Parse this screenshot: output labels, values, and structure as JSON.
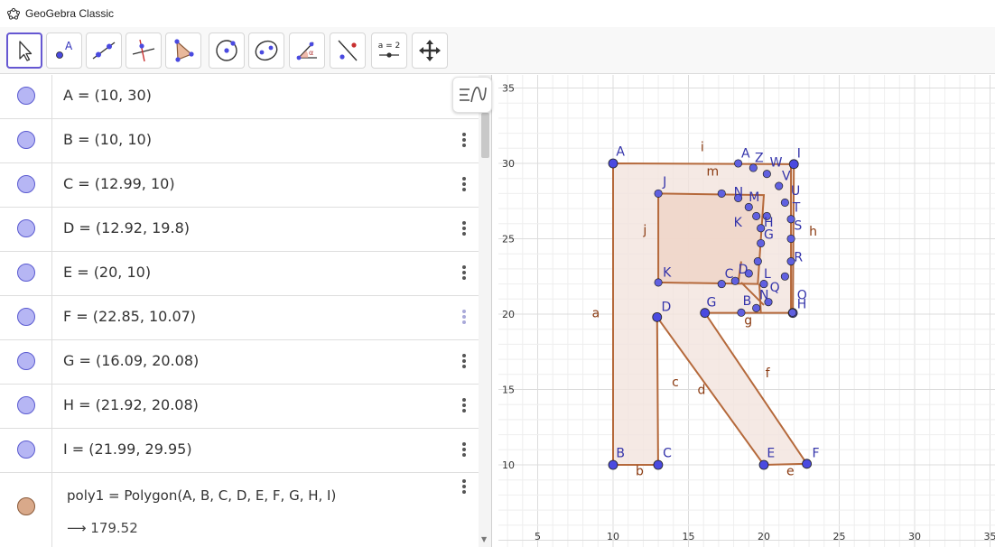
{
  "window": {
    "title": "GeoGebra Classic"
  },
  "toolbar": {
    "tools": [
      {
        "name": "move-tool",
        "icon": "arrow-cursor-icon",
        "selected": true
      },
      {
        "name": "point-tool",
        "icon": "point-icon",
        "label": "A"
      },
      {
        "name": "line-tool",
        "icon": "line-icon"
      },
      {
        "name": "perpendicular-line-tool",
        "icon": "perpendicular-icon"
      },
      {
        "name": "polygon-tool",
        "icon": "polygon-icon"
      },
      {
        "name": "circle-tool",
        "icon": "circle-center-point-icon"
      },
      {
        "name": "ellipse-tool",
        "icon": "ellipse-icon"
      },
      {
        "name": "angle-tool",
        "icon": "angle-icon",
        "label": "α"
      },
      {
        "name": "reflect-tool",
        "icon": "reflect-icon"
      },
      {
        "name": "slider-tool",
        "icon": "slider-icon",
        "label": "a = 2"
      },
      {
        "name": "move-graphics-tool",
        "icon": "move-graphics-icon"
      }
    ]
  },
  "algebra": {
    "rows": [
      {
        "expr": "A = (10, 30)"
      },
      {
        "expr": "B = (10, 10)"
      },
      {
        "expr": "C = (12.99, 10)"
      },
      {
        "expr": "D = (12.92, 19.8)"
      },
      {
        "expr": "E = (20, 10)"
      },
      {
        "expr": "F = (22.85, 10.07)"
      },
      {
        "expr": "G = (16.09, 20.08)"
      },
      {
        "expr": "H = (21.92, 20.08)"
      },
      {
        "expr": "I = (21.99, 29.95)"
      }
    ],
    "polygon_row": {
      "expr": "poly1 = Polygon(A, B, C, D, E, F, G, H, I)",
      "output": "179.52"
    }
  },
  "graphics": {
    "x_ticks": [
      "5",
      "10",
      "15",
      "20",
      "25",
      "30",
      "35"
    ],
    "y_ticks": [
      "35",
      "30",
      "25",
      "20",
      "15",
      "10"
    ],
    "colors": {
      "point": "#4a4ae0",
      "segment": "#b5693b",
      "fill": "#f3e4dd",
      "grid": "#dcdcdc",
      "grid_minor": "#eeeeee"
    },
    "labels": {
      "A": "A",
      "B": "B",
      "C": "C",
      "D": "D",
      "E": "E",
      "F": "F",
      "G": "G",
      "H": "H",
      "I": "I",
      "J": "J",
      "K": "K",
      "L": "L",
      "M": "M",
      "N": "N",
      "O": "O",
      "Q": "Q",
      "R": "R",
      "S": "S",
      "T": "T",
      "U": "U",
      "V": "V",
      "W": "W",
      "Z": "Z",
      "A1": "A",
      "B1": "B",
      "C1": "C",
      "D1": "D",
      "G1": "G",
      "H1": "H",
      "K1": "K",
      "M1": "M",
      "N1": "N",
      "N2": "N",
      "seg_a": "a",
      "seg_b": "b",
      "seg_c": "c",
      "seg_d": "d",
      "seg_e": "e",
      "seg_f": "f",
      "seg_g": "g",
      "seg_h": "h",
      "seg_i": "i",
      "seg_j": "j",
      "seg_m": "m"
    }
  }
}
